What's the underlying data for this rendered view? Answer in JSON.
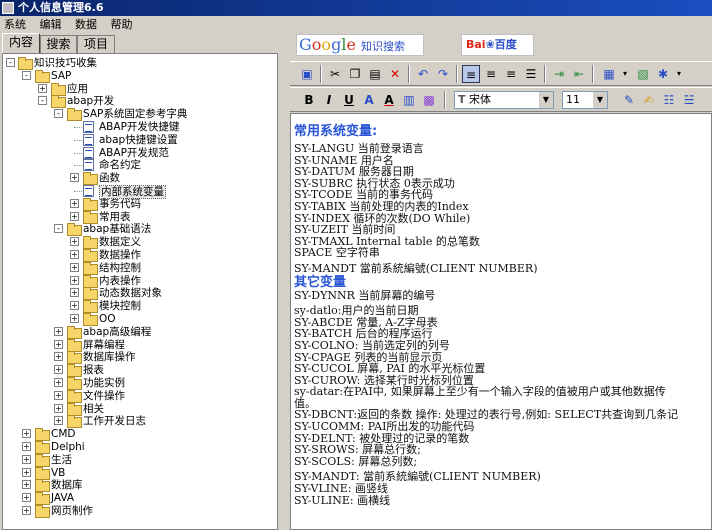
{
  "window": {
    "title": "个人信息管理6.6"
  },
  "menu": [
    "系统",
    "编辑",
    "数据",
    "帮助"
  ],
  "tabs": [
    "内容",
    "搜索",
    "项目"
  ],
  "tree": {
    "root": "知识技巧收集",
    "items": [
      {
        "label": "SAP",
        "indent": 1,
        "type": "folder",
        "expander": "-"
      },
      {
        "label": "应用",
        "indent": 2,
        "type": "folder",
        "expander": "+"
      },
      {
        "label": "abap开发",
        "indent": 2,
        "type": "folder",
        "expander": "-"
      },
      {
        "label": "SAP系统固定参考字典",
        "indent": 3,
        "type": "folder",
        "expander": "-"
      },
      {
        "label": "ABAP开发快捷键",
        "indent": 4,
        "type": "doc"
      },
      {
        "label": "abap快捷键设置",
        "indent": 4,
        "type": "doc"
      },
      {
        "label": "ABAP开发规范",
        "indent": 4,
        "type": "doc"
      },
      {
        "label": "命名约定",
        "indent": 4,
        "type": "doc"
      },
      {
        "label": "函数",
        "indent": 4,
        "type": "folder",
        "expander": "+"
      },
      {
        "label": "内部系统变量",
        "indent": 4,
        "type": "doc",
        "selected": true
      },
      {
        "label": "事务代码",
        "indent": 4,
        "type": "folder",
        "expander": "+"
      },
      {
        "label": "常用表",
        "indent": 4,
        "type": "folder",
        "expander": "+"
      },
      {
        "label": "abap基础语法",
        "indent": 3,
        "type": "folder",
        "expander": "-"
      },
      {
        "label": "数据定义",
        "indent": 4,
        "type": "folder",
        "expander": "+"
      },
      {
        "label": "数据操作",
        "indent": 4,
        "type": "folder",
        "expander": "+"
      },
      {
        "label": "结构控制",
        "indent": 4,
        "type": "folder",
        "expander": "+"
      },
      {
        "label": "内表操作",
        "indent": 4,
        "type": "folder",
        "expander": "+"
      },
      {
        "label": "动态数据对象",
        "indent": 4,
        "type": "folder",
        "expander": "+"
      },
      {
        "label": "模块控制",
        "indent": 4,
        "type": "folder",
        "expander": "+"
      },
      {
        "label": "OO",
        "indent": 4,
        "type": "folder",
        "expander": "+"
      },
      {
        "label": "abap高级编程",
        "indent": 3,
        "type": "folder",
        "expander": "+"
      },
      {
        "label": "屏幕编程",
        "indent": 3,
        "type": "folder",
        "expander": "+"
      },
      {
        "label": "数据库操作",
        "indent": 3,
        "type": "folder",
        "expander": "+"
      },
      {
        "label": "报表",
        "indent": 3,
        "type": "folder",
        "expander": "+"
      },
      {
        "label": "功能实例",
        "indent": 3,
        "type": "folder",
        "expander": "+"
      },
      {
        "label": "文件操作",
        "indent": 3,
        "type": "folder",
        "expander": "+"
      },
      {
        "label": "相关",
        "indent": 3,
        "type": "folder",
        "expander": "+"
      },
      {
        "label": "工作开发日志",
        "indent": 3,
        "type": "folder",
        "expander": "+"
      },
      {
        "label": "CMD",
        "indent": 1,
        "type": "folder",
        "expander": "+"
      },
      {
        "label": "Delphi",
        "indent": 1,
        "type": "folder",
        "expander": "+"
      },
      {
        "label": "生活",
        "indent": 1,
        "type": "folder",
        "expander": "+"
      },
      {
        "label": "VB",
        "indent": 1,
        "type": "folder",
        "expander": "+"
      },
      {
        "label": "数据库",
        "indent": 1,
        "type": "folder",
        "expander": "+"
      },
      {
        "label": "JAVA",
        "indent": 1,
        "type": "folder",
        "expander": "+"
      },
      {
        "label": "网页制作",
        "indent": 1,
        "type": "folder",
        "expander": "+"
      }
    ]
  },
  "search_bar": {
    "google_label": "Google",
    "google_suffix": "知识搜索",
    "baidu_bai": "Bai",
    "baidu_du": "百度"
  },
  "format_toolbar": {
    "bold": "B",
    "italic": "I",
    "underline": "U",
    "font_name": "宋体",
    "font_size": "11"
  },
  "editor": {
    "heading1": "常用系统变量:",
    "group1": [
      "SY-LANGU 当前登录语言",
      "SY-UNAME 用户名",
      "SY-DATUM 服务器日期",
      "SY-SUBRC 执行状态 0表示成功",
      "SY-TCODE 当前的事务代码",
      "SY-TABIX 当前处理的内表的Index",
      "SY-INDEX 循环的次数(DO While)",
      "SY-UZEIT 当前时间",
      "SY-TMAXL Internal table 的总笔数",
      "SPACE    空字符串"
    ],
    "line_mandt": "SY-MANDT 當前系統編號(CLIENT NUMBER)",
    "heading2": "其它变量",
    "line_dynnr": "SY-DYNNR 当前屏幕的编号",
    "group2": [
      "sy-datlo:用户的当前日期",
      "SY-ABCDE 常量, A-Z字母表",
      "SY-BATCH 后台的程序运行",
      "SY-COLNO: 当前选定列的列号",
      "SY-CPAGE 列表的当前显示页",
      "SY-CUCOL 屏幕, PAI 的水平光标位置",
      "SY-CUROW: 选择某行时光标列位置",
      "sy-datar:在PAI中, 如果屏幕上至少有一个输入字段的值被用户或其他数据传",
      "值。",
      "SY-DBCNT:返回的条数 操作: 处理过的表行号,例如: SELECT共查询到几条记",
      "SY-UCOMM: PAI所出发的功能代码",
      "SY-DELNT: 被处理过的记录的笔数",
      "SY-SROWS: 屏幕总行数;",
      "SY-SCOLS: 屏幕总列数;"
    ],
    "group3": [
      "SY-MANDT: 當前系統編號(CLIENT NUMBER)",
      "SY-VLINE: 画竖线",
      "SY-ULINE: 画横线"
    ]
  }
}
